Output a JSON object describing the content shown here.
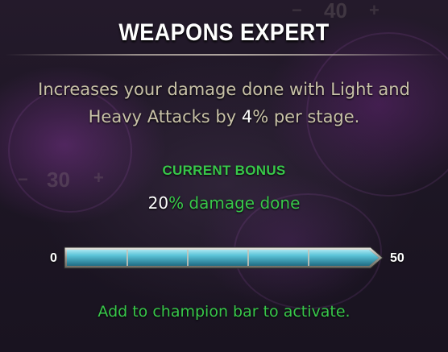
{
  "title": "WEAPONS EXPERT",
  "description": {
    "before": "Increases your damage done with Light and Heavy Attacks by ",
    "value": "4",
    "after": "% per stage."
  },
  "current_bonus": {
    "heading": "CURRENT BONUS",
    "value": "20",
    "suffix": "% damage done"
  },
  "progress_bar": {
    "min_label": "0",
    "max_label": "50",
    "min": 0,
    "max": 50,
    "current": 50,
    "segments": 5
  },
  "footer": "Add to champion bar to activate.",
  "background_nodes": {
    "top_value": "40",
    "left_value": "30",
    "minus_glyph": "−",
    "plus_glyph": "+"
  },
  "colors": {
    "heading": "#ffffff",
    "description": "#c9c2a8",
    "bonus_green": "#38c84a",
    "bar_fill": "#4ab8cc"
  }
}
